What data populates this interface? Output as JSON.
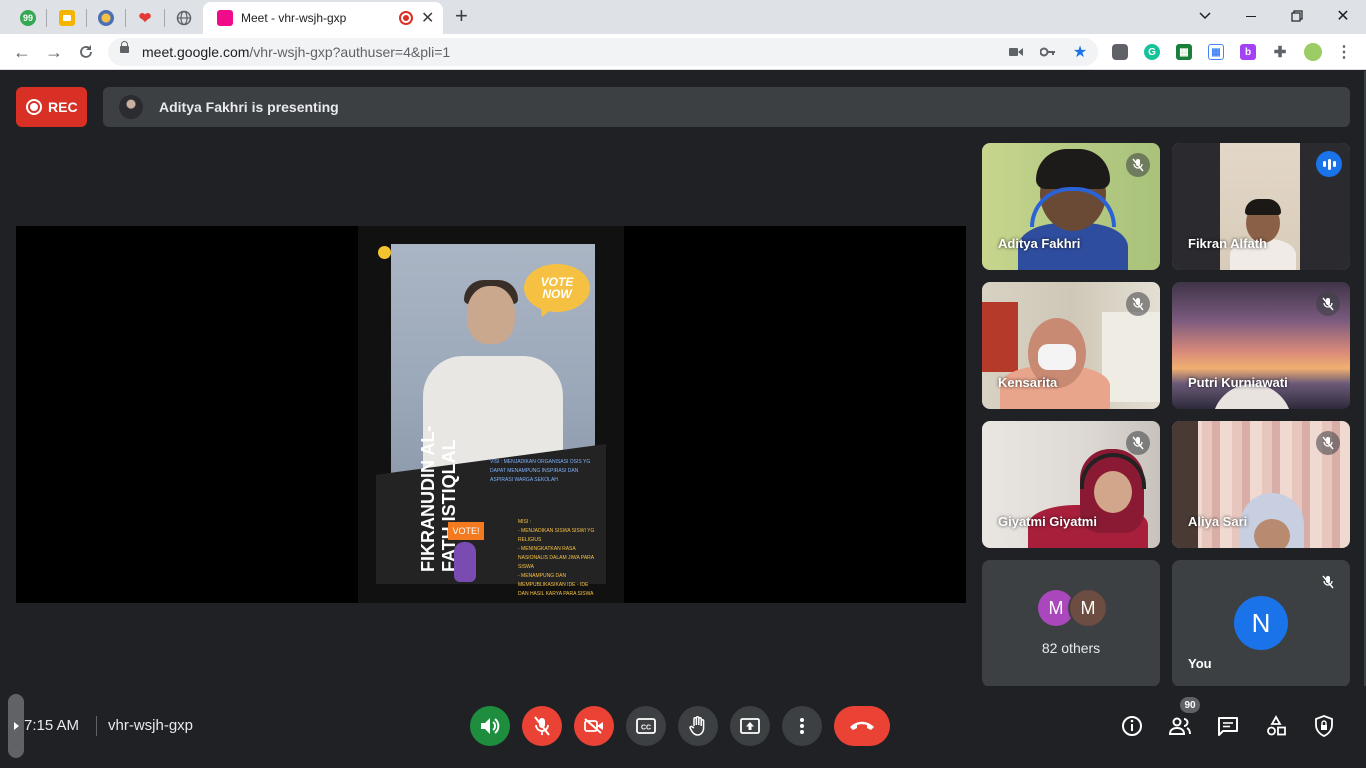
{
  "browser": {
    "pinned_tabs": [
      {
        "icon": "bookmark-99-icon",
        "label": "99",
        "color": "#34a853"
      },
      {
        "icon": "classroom-icon",
        "label": "",
        "color": "#f4b400"
      },
      {
        "icon": "school-logo-icon",
        "label": "",
        "color": "#4a6fb5"
      },
      {
        "icon": "heart-icon",
        "label": "",
        "color": "#e53935"
      },
      {
        "icon": "globe-icon",
        "label": "",
        "color": "#5f6368"
      }
    ],
    "active_tab_title": "Meet - vhr-wsjh-gxp",
    "url_host": "meet.google.com",
    "url_rest": "/vhr-wsjh-gxp?authuser=4&pli=1"
  },
  "meet": {
    "rec_label": "REC",
    "presenting_text": "Aditya Fakhri is presenting",
    "poster": {
      "vote_bubble": "VOTE NOW",
      "candidate_name": "FIKRANUDIN AL-\nFATH ISTIQLAL",
      "visi_text": "VISI : MENJADIKAN ORGANISASI OSIS YG DAPAT MENAMPUNG INSPIRASI DAN ASPIRASI WARGA SEKOLAH",
      "misi_text": "MISI :\n- MENJADIKAN SISWA SISWI YG RELIGIUS\n- MENINGKATKAN RASA NASIONALIS DALAM JIWA PARA SISWA\n- MENAMPUNG DAN MEMPUBLIKASIKAN IDE - IDE DAN HASIL KARYA PARA SISWA",
      "sign_text": "VOTE!"
    },
    "participants": [
      {
        "name": "Aditya Fakhri",
        "muted": true
      },
      {
        "name": "Fikran Alfath",
        "muted": false,
        "speaking": true
      },
      {
        "name": "Kensarita",
        "muted": true
      },
      {
        "name": "Putri Kurniawati",
        "muted": true
      },
      {
        "name": "Giyatmi Giyatmi",
        "muted": true
      },
      {
        "name": "Aliya Sari",
        "muted": true
      }
    ],
    "others": {
      "label": "82 others",
      "avatars": [
        {
          "letter": "M",
          "color": "#ab47bc"
        },
        {
          "letter": "M",
          "color": "#6d4c41"
        }
      ]
    },
    "self_tile": {
      "name": "You",
      "letter": "N",
      "color": "#1a73e8"
    },
    "bottom": {
      "time": "7:15 AM",
      "meeting_code": "vhr-wsjh-gxp",
      "people_count": "90"
    }
  }
}
